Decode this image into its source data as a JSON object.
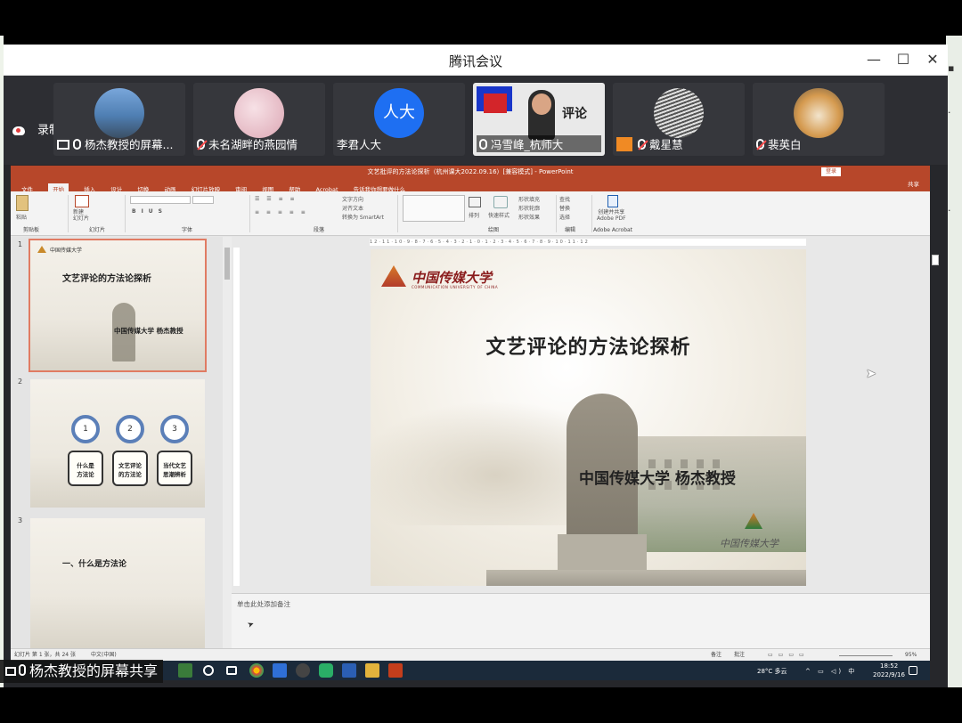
{
  "window": {
    "title": "腾讯会议",
    "minimize": "—",
    "maximize": "☐",
    "close": "✕"
  },
  "recording": {
    "label": "录制中"
  },
  "participants": [
    {
      "name": "杨杰教授的屏幕...",
      "sharing": true,
      "muted": false,
      "avatar_color": "#5b8fc9"
    },
    {
      "name": "未名湖畔的燕园情",
      "sharing": false,
      "muted": true,
      "avatar_color": "#e8b9c2"
    },
    {
      "name": "李君人大",
      "sharing": false,
      "muted": null,
      "avatar_text": "人大",
      "avatar_color": "#1e6ff2"
    },
    {
      "name": "冯雪峰_杭师大",
      "sharing": false,
      "muted": false,
      "video": true
    },
    {
      "name": "戴星慧",
      "sharing": false,
      "muted": true,
      "avatar_color": "#bdbdbd"
    },
    {
      "name": "裴英白",
      "sharing": false,
      "muted": true,
      "avatar_color": "#d9a257"
    }
  ],
  "ppt": {
    "title_bar": "文艺批评的方法论探析（杭州课大2022.09.16）[兼容模式] - PowerPoint",
    "sign_in": "登录",
    "tabs": [
      "文件",
      "开始",
      "插入",
      "设计",
      "切换",
      "动画",
      "幻灯片放映",
      "审阅",
      "视图",
      "帮助",
      "Acrobat",
      "告诉我你想要做什么"
    ],
    "active_tab": "开始",
    "share": "共享",
    "ribbon_groups": [
      "剪贴板",
      "幻灯片",
      "字体",
      "段落",
      "绘图",
      "编辑",
      "Adobe Acrobat"
    ],
    "ribbon_buttons": {
      "paste": "粘贴",
      "new_slide": "新建\n幻灯片",
      "arrange": "排列",
      "quick_styles": "快速样式",
      "find": "查找",
      "replace": "替换",
      "select": "选择",
      "create_pdf": "创建并共享\nAdobe PDF",
      "text_direction": "文字方向",
      "align_text": "对齐文本",
      "smartart": "转换为 SmartArt",
      "shape_fill": "形状填充",
      "shape_outline": "形状轮廓",
      "shape_effects": "形状效果"
    },
    "thumbnails": [
      {
        "num": "1",
        "title": "文艺评论的方法论探析",
        "sub": "中国传媒大学  杨杰教授"
      },
      {
        "num": "2",
        "circles": [
          "1",
          "2",
          "3"
        ],
        "boxes": [
          "什么是\n方法论",
          "文艺评论\n的方法论",
          "当代文艺\n思潮辨析"
        ]
      },
      {
        "num": "3",
        "title": "一、什么是方法论"
      }
    ],
    "slide": {
      "logo": "中国传媒大学",
      "logo_sub": "COMMUNICATION UNIVERSITY OF CHINA",
      "title": "文艺评论的方法论探析",
      "subtitle": "中国传媒大学  杨杰教授",
      "logo2": "中国传媒大学"
    },
    "ruler": "12·11·10·9·8·7·6·5·4·3·2·1·0·1·2·3·4·5·6·7·8·9·10·11·12",
    "notes_placeholder": "单击此处添加备注",
    "status": {
      "slide_count": "幻灯片 第 1 张，共 24 张",
      "language": "中文(中国)",
      "notes": "备注",
      "comments": "批注",
      "zoom": "95%"
    }
  },
  "taskbar": {
    "weather": "28°C  多云",
    "time": "18:52",
    "date": "2022/9/16"
  },
  "share_badge": {
    "label": "杨杰教授的屏幕共享"
  }
}
